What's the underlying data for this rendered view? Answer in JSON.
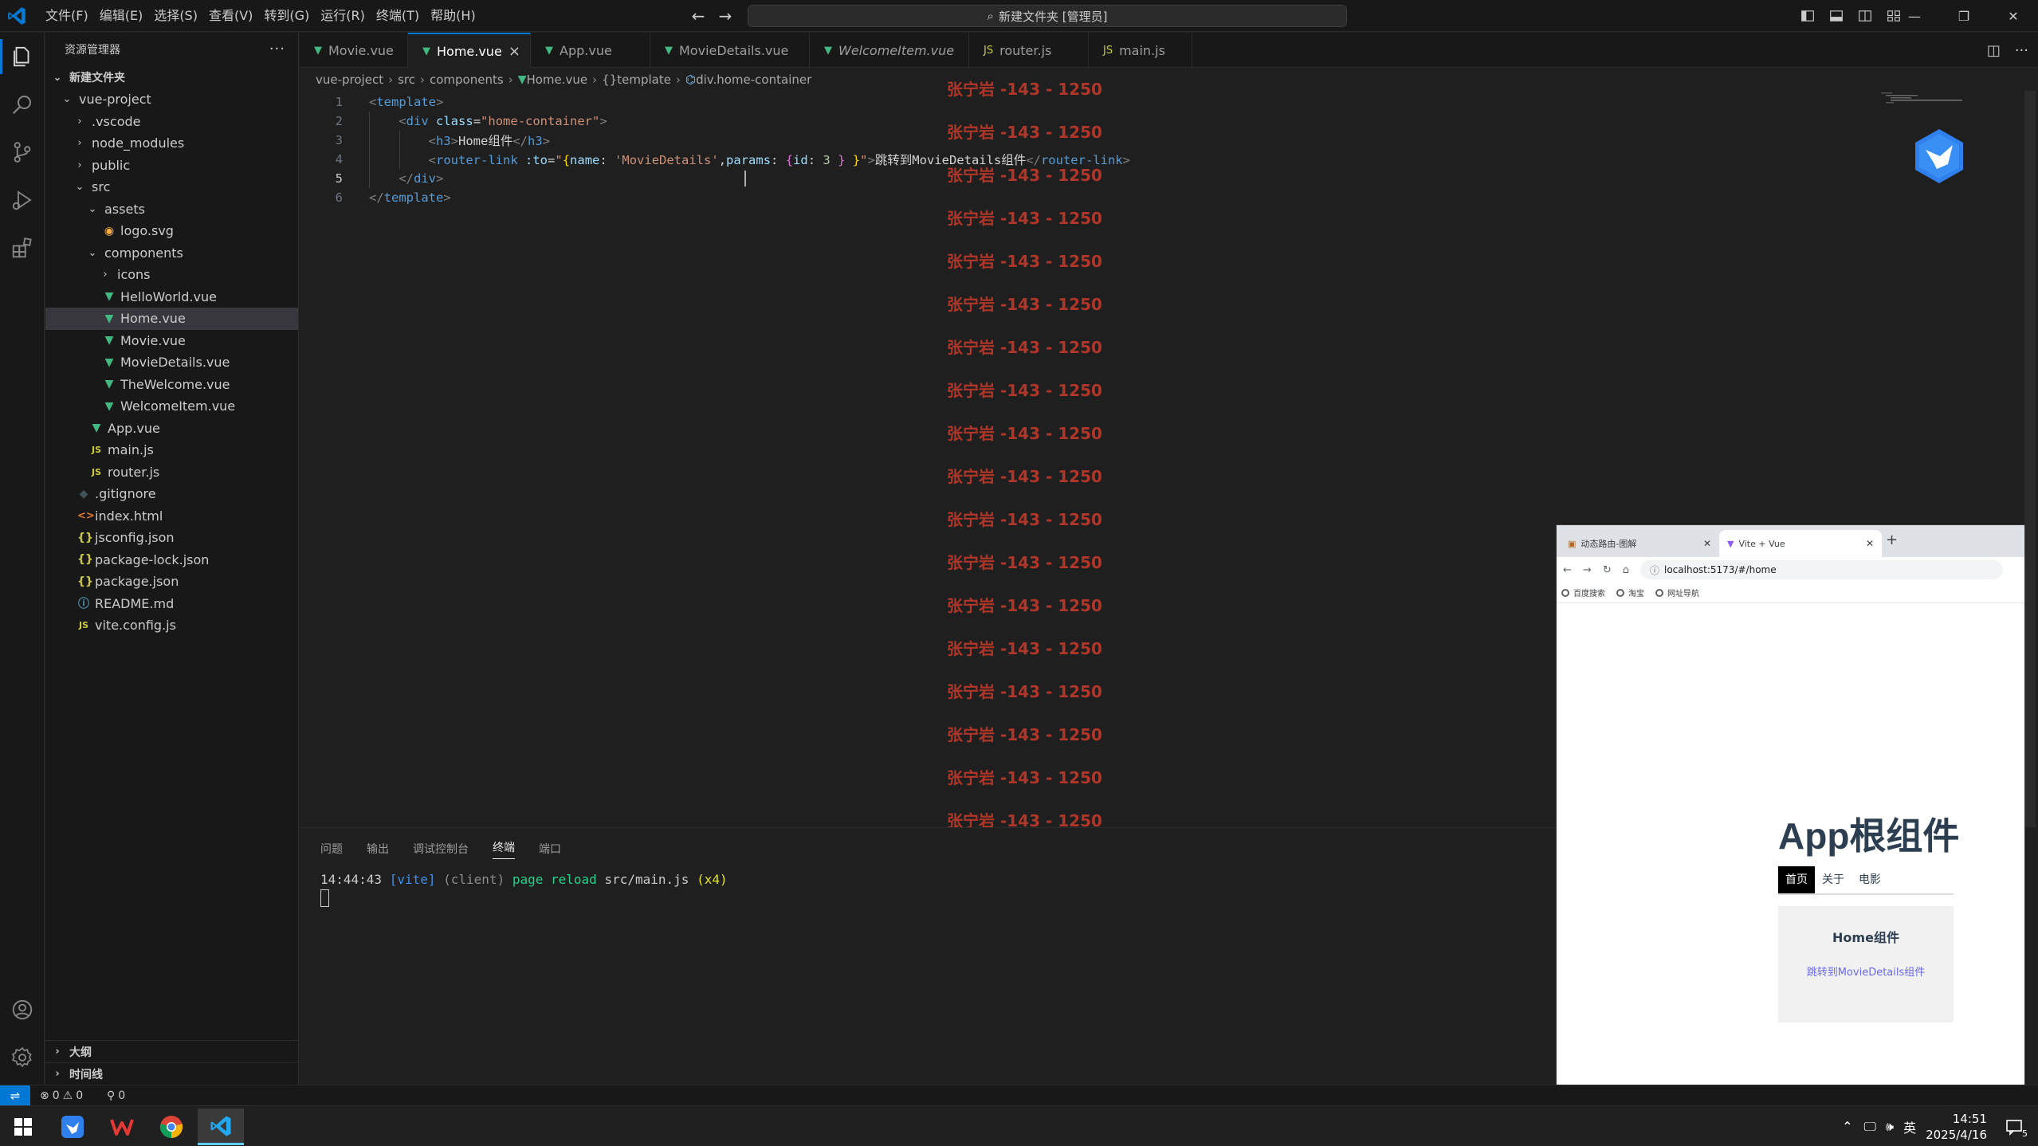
{
  "titlebar": {
    "menus": [
      "文件(F)",
      "编辑(E)",
      "选择(S)",
      "查看(V)",
      "转到(G)",
      "运行(R)",
      "终端(T)",
      "帮助(H)"
    ],
    "command_center": "新建文件夹 [管理员]"
  },
  "sidebar": {
    "title": "资源管理器",
    "root": "新建文件夹",
    "tree": [
      {
        "label": "vue-project",
        "type": "folder-open",
        "depth": 0
      },
      {
        "label": ".vscode",
        "type": "folder",
        "depth": 1
      },
      {
        "label": "node_modules",
        "type": "folder",
        "depth": 1
      },
      {
        "label": "public",
        "type": "folder",
        "depth": 1
      },
      {
        "label": "src",
        "type": "folder-open",
        "depth": 1
      },
      {
        "label": "assets",
        "type": "folder-open",
        "depth": 2
      },
      {
        "label": "logo.svg",
        "type": "svg",
        "depth": 3
      },
      {
        "label": "components",
        "type": "folder-open",
        "depth": 2
      },
      {
        "label": "icons",
        "type": "folder",
        "depth": 3
      },
      {
        "label": "HelloWorld.vue",
        "type": "vue",
        "depth": 3
      },
      {
        "label": "Home.vue",
        "type": "vue",
        "depth": 3,
        "selected": true
      },
      {
        "label": "Movie.vue",
        "type": "vue",
        "depth": 3
      },
      {
        "label": "MovieDetails.vue",
        "type": "vue",
        "depth": 3
      },
      {
        "label": "TheWelcome.vue",
        "type": "vue",
        "depth": 3
      },
      {
        "label": "WelcomeItem.vue",
        "type": "vue",
        "depth": 3
      },
      {
        "label": "App.vue",
        "type": "vue",
        "depth": 2
      },
      {
        "label": "main.js",
        "type": "js",
        "depth": 2
      },
      {
        "label": "router.js",
        "type": "js",
        "depth": 2
      },
      {
        "label": ".gitignore",
        "type": "git",
        "depth": 1
      },
      {
        "label": "index.html",
        "type": "html",
        "depth": 1
      },
      {
        "label": "jsconfig.json",
        "type": "json",
        "depth": 1
      },
      {
        "label": "package-lock.json",
        "type": "json",
        "depth": 1
      },
      {
        "label": "package.json",
        "type": "json",
        "depth": 1
      },
      {
        "label": "README.md",
        "type": "info",
        "depth": 1
      },
      {
        "label": "vite.config.js",
        "type": "js",
        "depth": 1
      }
    ],
    "sections": [
      "大纲",
      "时间线"
    ]
  },
  "tabs": [
    {
      "label": "Movie.vue",
      "icon": "vue"
    },
    {
      "label": "Home.vue",
      "icon": "vue",
      "active": true
    },
    {
      "label": "App.vue",
      "icon": "vue"
    },
    {
      "label": "MovieDetails.vue",
      "icon": "vue"
    },
    {
      "label": "WelcomeItem.vue",
      "icon": "vue",
      "italic": true
    },
    {
      "label": "router.js",
      "icon": "js"
    },
    {
      "label": "main.js",
      "icon": "js"
    }
  ],
  "breadcrumb": [
    "vue-project",
    "src",
    "components",
    "Home.vue",
    "template",
    "div.home-container"
  ],
  "editor": {
    "current_line": 5,
    "lines": [
      {
        "n": "1",
        "tokens": [
          [
            "t-tag",
            "<"
          ],
          [
            "t-name",
            "template"
          ],
          [
            "t-tag",
            ">"
          ]
        ]
      },
      {
        "n": "2",
        "tokens": [
          [
            "t-txt",
            "    "
          ],
          [
            "t-tag",
            "<"
          ],
          [
            "t-name",
            "div"
          ],
          [
            "t-txt",
            " "
          ],
          [
            "t-attr",
            "class"
          ],
          [
            "t-txt",
            "="
          ],
          [
            "t-str",
            "\"home-container\""
          ],
          [
            "t-tag",
            ">"
          ]
        ]
      },
      {
        "n": "3",
        "tokens": [
          [
            "t-txt",
            "        "
          ],
          [
            "t-tag",
            "<"
          ],
          [
            "t-name",
            "h3"
          ],
          [
            "t-tag",
            ">"
          ],
          [
            "t-txt",
            "Home组件"
          ],
          [
            "t-tag",
            "</"
          ],
          [
            "t-name",
            "h3"
          ],
          [
            "t-tag",
            ">"
          ]
        ]
      },
      {
        "n": "4",
        "tokens": [
          [
            "t-txt",
            "        "
          ],
          [
            "t-tag",
            "<"
          ],
          [
            "t-name",
            "router-link"
          ],
          [
            "t-txt",
            " "
          ],
          [
            "t-attr",
            ":to"
          ],
          [
            "t-txt",
            "="
          ],
          [
            "t-str",
            "\""
          ],
          [
            "t-br2",
            "{"
          ],
          [
            "t-attr",
            "name"
          ],
          [
            "t-txt",
            ": "
          ],
          [
            "t-str",
            "'MovieDetails'"
          ],
          [
            "t-txt",
            ","
          ],
          [
            "t-attr",
            "params"
          ],
          [
            "t-txt",
            ": "
          ],
          [
            "t-br",
            "{"
          ],
          [
            "t-attr",
            "id"
          ],
          [
            "t-txt",
            ": "
          ],
          [
            "t-num",
            "3"
          ],
          [
            "t-txt",
            " "
          ],
          [
            "t-br",
            "}"
          ],
          [
            "t-txt",
            " "
          ],
          [
            "t-br2",
            "}"
          ],
          [
            "t-str",
            "\""
          ],
          [
            "t-tag",
            ">"
          ],
          [
            "t-txt",
            "跳转到MovieDetails组件"
          ],
          [
            "t-tag",
            "</"
          ],
          [
            "t-name",
            "router-link"
          ],
          [
            "t-tag",
            ">"
          ]
        ]
      },
      {
        "n": "5",
        "tokens": [
          [
            "t-txt",
            "    "
          ],
          [
            "t-tag",
            "</"
          ],
          [
            "t-name",
            "div"
          ],
          [
            "t-tag",
            ">"
          ]
        ]
      },
      {
        "n": "6",
        "tokens": [
          [
            "t-tag",
            "</"
          ],
          [
            "t-name",
            "template"
          ],
          [
            "t-tag",
            ">"
          ]
        ]
      }
    ]
  },
  "watermark": "张宁岩 -143 - 1250",
  "panel": {
    "tabs": [
      "问题",
      "输出",
      "调试控制台",
      "终端",
      "端口"
    ],
    "active_tab": "终端",
    "terminal": {
      "time": "14:44:43",
      "vite": "[vite]",
      "client": "(client)",
      "msg": "page reload",
      "file": "src/main.js",
      "count": "(x4)"
    }
  },
  "browser": {
    "tabs": [
      {
        "label": "动态路由-图解"
      },
      {
        "label": "Vite + Vue",
        "active": true
      }
    ],
    "url": "localhost:5173/#/home",
    "bookmarks": [
      "百度搜索",
      "淘宝",
      "网址导航"
    ],
    "app_title": "App根组件",
    "nav": [
      {
        "label": "首页",
        "active": true
      },
      {
        "label": "关于"
      },
      {
        "label": "电影"
      }
    ],
    "home_heading": "Home组件",
    "home_link": "跳转到MovieDetails组件"
  },
  "statusbar": {
    "errors": "0",
    "warnings": "0",
    "ports": "0"
  },
  "taskbar": {
    "ime": "英",
    "time": "14:51",
    "date": "2025/4/16",
    "notifications": "5"
  }
}
